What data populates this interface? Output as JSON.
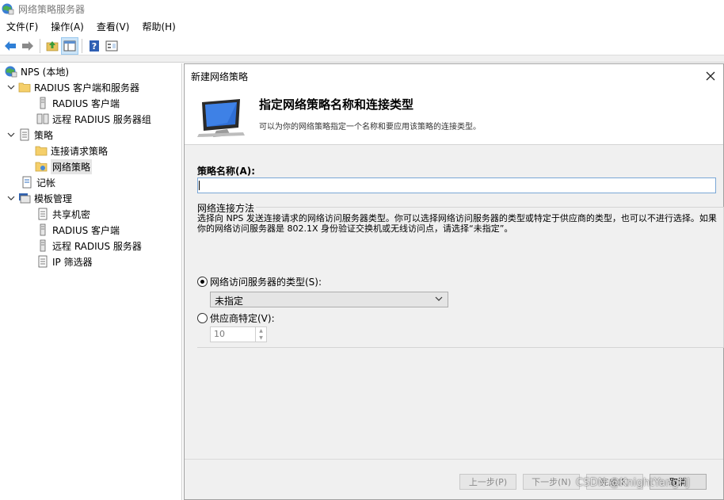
{
  "window": {
    "title": "网络策略服务器"
  },
  "menu": [
    "文件(F)",
    "操作(A)",
    "查看(V)",
    "帮助(H)"
  ],
  "toolbar": {
    "icons": [
      "back-arrow-icon",
      "forward-arrow-icon",
      "folder-up-icon",
      "console-tree-icon",
      "help-icon",
      "properties-icon"
    ]
  },
  "tree": {
    "items": [
      {
        "label": "NPS (本地)"
      },
      {
        "label": "RADIUS 客户端和服务器"
      },
      {
        "label": "RADIUS 客户端"
      },
      {
        "label": "远程 RADIUS 服务器组"
      },
      {
        "label": "策略"
      },
      {
        "label": "连接请求策略"
      },
      {
        "label": "网络策略"
      },
      {
        "label": "记帐"
      },
      {
        "label": "模板管理"
      },
      {
        "label": "共享机密"
      },
      {
        "label": "RADIUS 客户端"
      },
      {
        "label": "远程 RADIUS 服务器"
      },
      {
        "label": "IP 筛选器"
      }
    ]
  },
  "dialog": {
    "title": "新建网络策略",
    "header_title": "指定网络策略名称和连接类型",
    "header_desc": "可以为你的网络策略指定一个名称和要应用该策略的连接类型。",
    "name_label": "策略名称(A):",
    "name_value": "",
    "group_label": "网络连接方法",
    "group_desc": "选择向 NPS 发送连接请求的网络访问服务器类型。你可以选择网络访问服务器的类型或特定于供应商的类型，也可以不进行选择。如果你的网络访问服务器是 802.1X 身份验证交换机或无线访问点，请选择“未指定”。",
    "radio_type_label": "网络访问服务器的类型(S):",
    "radio_type_checked": true,
    "select_value": "未指定",
    "radio_vendor_label": "供应商特定(V):",
    "radio_vendor_checked": false,
    "vendor_value": "10",
    "buttons": {
      "prev": "上一步(P)",
      "next": "下一步(N)",
      "finish": "完成(F)",
      "cancel": "取消"
    }
  },
  "watermark": "CSDN @KnightYangHJ",
  "colors": {
    "selection": "#cce4f7",
    "dialog_bg": "#f0f0f0",
    "input_border": "#7aa7d6"
  }
}
